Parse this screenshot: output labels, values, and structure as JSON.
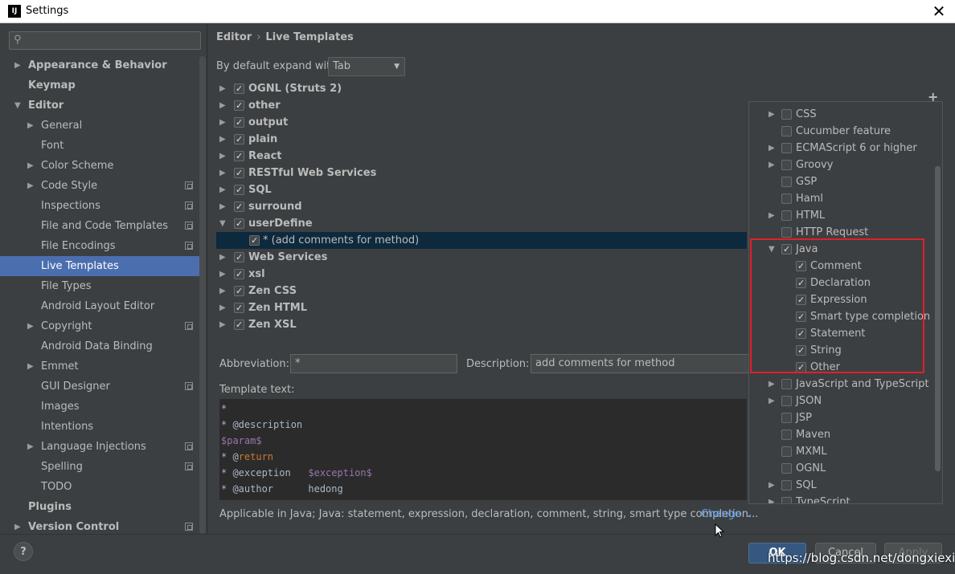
{
  "window": {
    "title": "Settings",
    "app_icon": "IJ"
  },
  "search": {
    "placeholder": "",
    "icon": "search-icon"
  },
  "sidebar": {
    "items": [
      {
        "label": "Appearance & Behavior",
        "arrow": "▶",
        "bold": true,
        "indent": 0
      },
      {
        "label": "Keymap",
        "arrow": "",
        "bold": true,
        "indent": 0
      },
      {
        "label": "Editor",
        "arrow": "▼",
        "bold": true,
        "indent": 0
      },
      {
        "label": "General",
        "arrow": "▶",
        "bold": false,
        "indent": 1
      },
      {
        "label": "Font",
        "arrow": "",
        "bold": false,
        "indent": 1
      },
      {
        "label": "Color Scheme",
        "arrow": "▶",
        "bold": false,
        "indent": 1
      },
      {
        "label": "Code Style",
        "arrow": "▶",
        "bold": false,
        "indent": 1,
        "copy": true
      },
      {
        "label": "Inspections",
        "arrow": "",
        "bold": false,
        "indent": 1,
        "copy": true
      },
      {
        "label": "File and Code Templates",
        "arrow": "",
        "bold": false,
        "indent": 1,
        "copy": true
      },
      {
        "label": "File Encodings",
        "arrow": "",
        "bold": false,
        "indent": 1,
        "copy": true
      },
      {
        "label": "Live Templates",
        "arrow": "",
        "bold": false,
        "indent": 1,
        "selected": true
      },
      {
        "label": "File Types",
        "arrow": "",
        "bold": false,
        "indent": 1
      },
      {
        "label": "Android Layout Editor",
        "arrow": "",
        "bold": false,
        "indent": 1
      },
      {
        "label": "Copyright",
        "arrow": "▶",
        "bold": false,
        "indent": 1,
        "copy": true
      },
      {
        "label": "Android Data Binding",
        "arrow": "",
        "bold": false,
        "indent": 1
      },
      {
        "label": "Emmet",
        "arrow": "▶",
        "bold": false,
        "indent": 1
      },
      {
        "label": "GUI Designer",
        "arrow": "",
        "bold": false,
        "indent": 1,
        "copy": true
      },
      {
        "label": "Images",
        "arrow": "",
        "bold": false,
        "indent": 1
      },
      {
        "label": "Intentions",
        "arrow": "",
        "bold": false,
        "indent": 1
      },
      {
        "label": "Language Injections",
        "arrow": "▶",
        "bold": false,
        "indent": 1,
        "copy": true
      },
      {
        "label": "Spelling",
        "arrow": "",
        "bold": false,
        "indent": 1,
        "copy": true
      },
      {
        "label": "TODO",
        "arrow": "",
        "bold": false,
        "indent": 1
      },
      {
        "label": "Plugins",
        "arrow": "",
        "bold": true,
        "indent": 0
      },
      {
        "label": "Version Control",
        "arrow": "▶",
        "bold": true,
        "indent": 0,
        "copy": true
      }
    ]
  },
  "breadcrumb": {
    "parent": "Editor",
    "separator": "›",
    "current": "Live Templates"
  },
  "expand": {
    "label": "By default expand with",
    "value": "Tab"
  },
  "template_groups": [
    {
      "label": "OGNL (Struts 2)",
      "arrow": "▶",
      "checked": true,
      "bold": true,
      "child": false
    },
    {
      "label": "other",
      "arrow": "▶",
      "checked": true,
      "bold": true,
      "child": false
    },
    {
      "label": "output",
      "arrow": "▶",
      "checked": true,
      "bold": true,
      "child": false
    },
    {
      "label": "plain",
      "arrow": "▶",
      "checked": true,
      "bold": true,
      "child": false
    },
    {
      "label": "React",
      "arrow": "▶",
      "checked": true,
      "bold": true,
      "child": false
    },
    {
      "label": "RESTful Web Services",
      "arrow": "▶",
      "checked": true,
      "bold": true,
      "child": false
    },
    {
      "label": "SQL",
      "arrow": "▶",
      "checked": true,
      "bold": true,
      "child": false
    },
    {
      "label": "surround",
      "arrow": "▶",
      "checked": true,
      "bold": true,
      "child": false
    },
    {
      "label": "userDefine",
      "arrow": "▼",
      "checked": true,
      "bold": true,
      "child": false
    },
    {
      "label": "* (add comments for method)",
      "arrow": "",
      "checked": true,
      "bold": false,
      "child": true,
      "selected": true
    },
    {
      "label": "Web Services",
      "arrow": "▶",
      "checked": true,
      "bold": true,
      "child": false
    },
    {
      "label": "xsl",
      "arrow": "▶",
      "checked": true,
      "bold": true,
      "child": false
    },
    {
      "label": "Zen CSS",
      "arrow": "▶",
      "checked": true,
      "bold": true,
      "child": false
    },
    {
      "label": "Zen HTML",
      "arrow": "▶",
      "checked": true,
      "bold": true,
      "child": false
    },
    {
      "label": "Zen XSL",
      "arrow": "▶",
      "checked": true,
      "bold": true,
      "child": false
    }
  ],
  "toolbar": {
    "add_label": "+"
  },
  "abbreviation": {
    "label": "Abbreviation:",
    "value": "*"
  },
  "description": {
    "label": "Description:",
    "value": "add comments for method"
  },
  "template_text": {
    "label": "Template text:",
    "lines": [
      [
        {
          "t": "*",
          "c": ""
        }
      ],
      [
        {
          "t": "* @description",
          "c": ""
        }
      ],
      [
        {
          "t": "$param$",
          "c": "var"
        }
      ],
      [
        {
          "t": "* @",
          "c": ""
        },
        {
          "t": "return",
          "c": "kw"
        }
      ],
      [
        {
          "t": "* @exception   ",
          "c": ""
        },
        {
          "t": "$exception$",
          "c": "var"
        }
      ],
      [
        {
          "t": "* @author      hedong",
          "c": ""
        }
      ]
    ]
  },
  "applicable": {
    "text": "Applicable in Java; Java: statement, expression, declaration, comment, string, smart type completion...",
    "change_label": "Change",
    "change_caret": "⌄"
  },
  "contexts": [
    {
      "label": "CSS",
      "arrow": "▶",
      "checked": false,
      "indent": 0
    },
    {
      "label": "Cucumber feature",
      "arrow": "",
      "checked": false,
      "indent": 0
    },
    {
      "label": "ECMAScript 6 or higher",
      "arrow": "▶",
      "checked": false,
      "indent": 0
    },
    {
      "label": "Groovy",
      "arrow": "▶",
      "checked": false,
      "indent": 0
    },
    {
      "label": "GSP",
      "arrow": "",
      "checked": false,
      "indent": 0
    },
    {
      "label": "Haml",
      "arrow": "",
      "checked": false,
      "indent": 0
    },
    {
      "label": "HTML",
      "arrow": "▶",
      "checked": false,
      "indent": 0
    },
    {
      "label": "HTTP Request",
      "arrow": "",
      "checked": false,
      "indent": 0
    },
    {
      "label": "Java",
      "arrow": "▼",
      "checked": true,
      "indent": 0
    },
    {
      "label": "Comment",
      "arrow": "",
      "checked": true,
      "indent": 1
    },
    {
      "label": "Declaration",
      "arrow": "",
      "checked": true,
      "indent": 1
    },
    {
      "label": "Expression",
      "arrow": "",
      "checked": true,
      "indent": 1
    },
    {
      "label": "Smart type completion",
      "arrow": "",
      "checked": true,
      "indent": 1
    },
    {
      "label": "Statement",
      "arrow": "",
      "checked": true,
      "indent": 1
    },
    {
      "label": "String",
      "arrow": "",
      "checked": true,
      "indent": 1
    },
    {
      "label": "Other",
      "arrow": "",
      "checked": true,
      "indent": 1
    },
    {
      "label": "JavaScript and TypeScript",
      "arrow": "▶",
      "checked": false,
      "indent": 0
    },
    {
      "label": "JSON",
      "arrow": "▶",
      "checked": false,
      "indent": 0
    },
    {
      "label": "JSP",
      "arrow": "",
      "checked": false,
      "indent": 0
    },
    {
      "label": "Maven",
      "arrow": "",
      "checked": false,
      "indent": 0
    },
    {
      "label": "MXML",
      "arrow": "",
      "checked": false,
      "indent": 0
    },
    {
      "label": "OGNL",
      "arrow": "",
      "checked": false,
      "indent": 0
    },
    {
      "label": "SQL",
      "arrow": "▶",
      "checked": false,
      "indent": 0
    },
    {
      "label": "TypeScript",
      "arrow": "▶",
      "checked": false,
      "indent": 0
    }
  ],
  "footer": {
    "help_label": "?",
    "ok_label": "OK",
    "cancel_label": "Cancel",
    "apply_label": "Apply",
    "watermark": "https://blog.csdn.net/dongxiexie"
  },
  "colors": {
    "accent": "#4b6eaf",
    "highlight_box": "#e0202a",
    "link": "#589df6"
  }
}
